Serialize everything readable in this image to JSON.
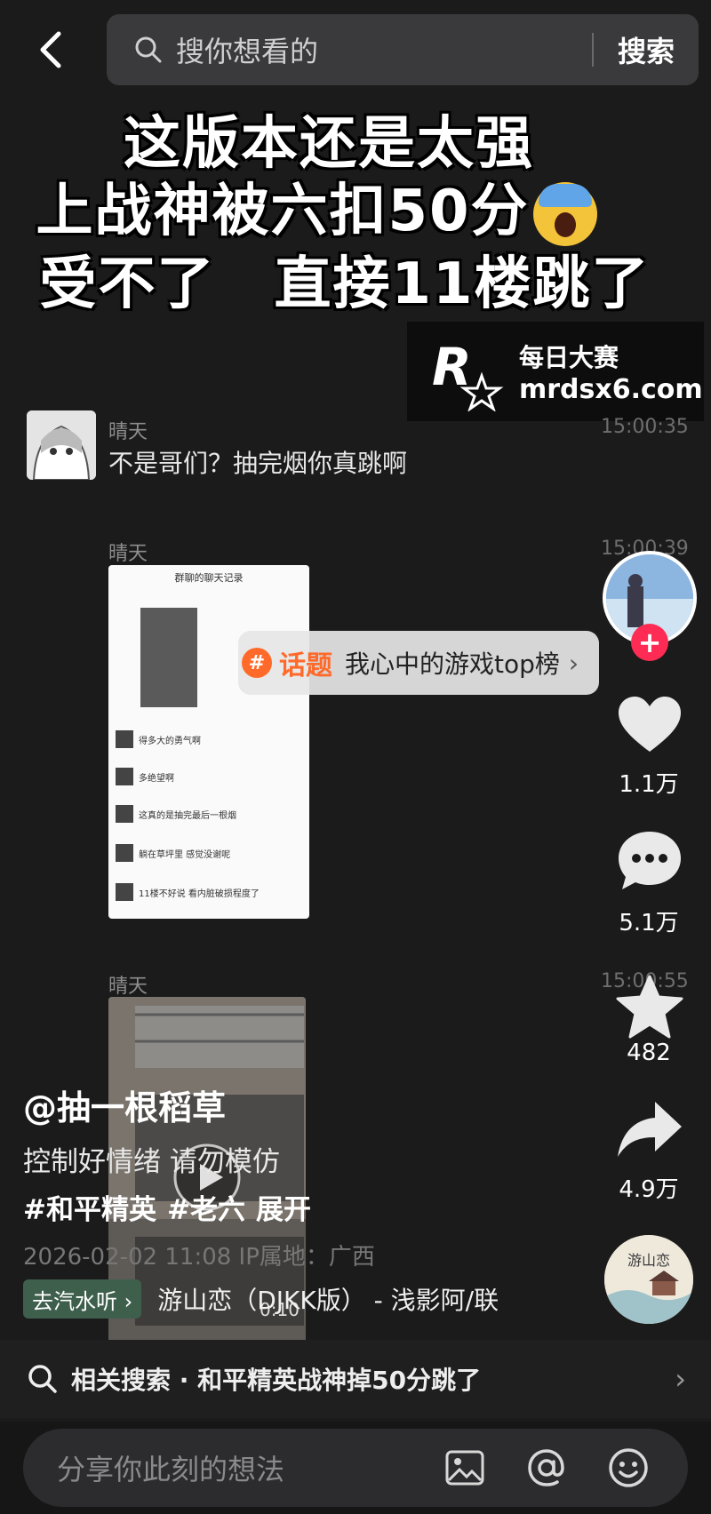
{
  "search": {
    "placeholder": "搜你想看的",
    "button": "搜索"
  },
  "caption": {
    "line1": "这版本还是太强",
    "line2": "上战神被六扣50分",
    "line3": "受不了　直接11楼跳了"
  },
  "watermark": {
    "name": "每日大赛",
    "url": "mrdsx6.com",
    "logo_letter": "R",
    "logo_small": "每日大赛"
  },
  "chat": [
    {
      "name": "晴天",
      "time": "15:00:35",
      "text": "不是哥们？抽完烟你真跳啊"
    },
    {
      "name": "晴天",
      "time": "15:00:39"
    },
    {
      "name": "晴天",
      "time": "15:00:55"
    }
  ],
  "screenshot": {
    "title": "群聊的聊天记录",
    "rows": [
      "得多大的勇气啊",
      "多绝望啊",
      "这真的是抽完最后一根烟",
      "躺在草坪里 感觉没谢呢",
      "11楼不好说 看内脏破损程度了"
    ]
  },
  "topic": {
    "label": "话题",
    "text": "我心中的游戏top榜"
  },
  "rail": {
    "likes": "1.1万",
    "comments": "5.1万",
    "favorites": "482",
    "shares": "4.9万",
    "disc_text": "游山恋"
  },
  "post": {
    "author": "@抽一根稻草",
    "description": "控制好情绪 请勿模仿",
    "tags": [
      "#和平精英",
      "#老六",
      "展开"
    ],
    "meta": "2026-02-02 11:08  IP属地：广西",
    "music_badge": "去汽水听 ›",
    "music_title": "游山恋（DJKK版） - 浅影阿/联",
    "video_duration": "0:10"
  },
  "related": {
    "text": "相关搜索 · 和平精英战神掉50分跳了"
  },
  "composer": {
    "placeholder": "分享你此刻的想法"
  },
  "colors": {
    "accent": "#fe2c55",
    "topic": "#ff6a2b",
    "music_badge": "#3f5f4d"
  }
}
